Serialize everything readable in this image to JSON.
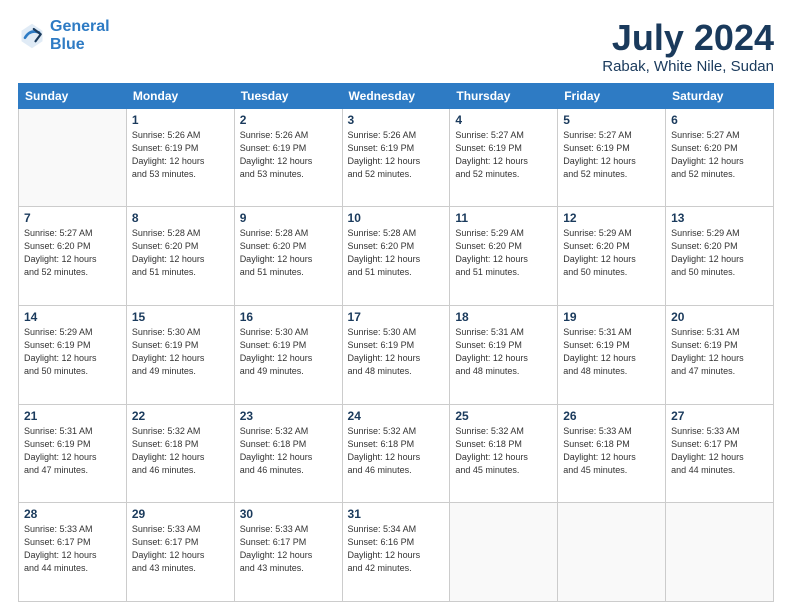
{
  "header": {
    "logo_line1": "General",
    "logo_line2": "Blue",
    "title": "July 2024",
    "subtitle": "Rabak, White Nile, Sudan"
  },
  "calendar": {
    "days_of_week": [
      "Sunday",
      "Monday",
      "Tuesday",
      "Wednesday",
      "Thursday",
      "Friday",
      "Saturday"
    ],
    "weeks": [
      [
        {
          "day": "",
          "info": ""
        },
        {
          "day": "1",
          "info": "Sunrise: 5:26 AM\nSunset: 6:19 PM\nDaylight: 12 hours\nand 53 minutes."
        },
        {
          "day": "2",
          "info": "Sunrise: 5:26 AM\nSunset: 6:19 PM\nDaylight: 12 hours\nand 53 minutes."
        },
        {
          "day": "3",
          "info": "Sunrise: 5:26 AM\nSunset: 6:19 PM\nDaylight: 12 hours\nand 52 minutes."
        },
        {
          "day": "4",
          "info": "Sunrise: 5:27 AM\nSunset: 6:19 PM\nDaylight: 12 hours\nand 52 minutes."
        },
        {
          "day": "5",
          "info": "Sunrise: 5:27 AM\nSunset: 6:19 PM\nDaylight: 12 hours\nand 52 minutes."
        },
        {
          "day": "6",
          "info": "Sunrise: 5:27 AM\nSunset: 6:20 PM\nDaylight: 12 hours\nand 52 minutes."
        }
      ],
      [
        {
          "day": "7",
          "info": "Sunrise: 5:27 AM\nSunset: 6:20 PM\nDaylight: 12 hours\nand 52 minutes."
        },
        {
          "day": "8",
          "info": "Sunrise: 5:28 AM\nSunset: 6:20 PM\nDaylight: 12 hours\nand 51 minutes."
        },
        {
          "day": "9",
          "info": "Sunrise: 5:28 AM\nSunset: 6:20 PM\nDaylight: 12 hours\nand 51 minutes."
        },
        {
          "day": "10",
          "info": "Sunrise: 5:28 AM\nSunset: 6:20 PM\nDaylight: 12 hours\nand 51 minutes."
        },
        {
          "day": "11",
          "info": "Sunrise: 5:29 AM\nSunset: 6:20 PM\nDaylight: 12 hours\nand 51 minutes."
        },
        {
          "day": "12",
          "info": "Sunrise: 5:29 AM\nSunset: 6:20 PM\nDaylight: 12 hours\nand 50 minutes."
        },
        {
          "day": "13",
          "info": "Sunrise: 5:29 AM\nSunset: 6:20 PM\nDaylight: 12 hours\nand 50 minutes."
        }
      ],
      [
        {
          "day": "14",
          "info": "Sunrise: 5:29 AM\nSunset: 6:19 PM\nDaylight: 12 hours\nand 50 minutes."
        },
        {
          "day": "15",
          "info": "Sunrise: 5:30 AM\nSunset: 6:19 PM\nDaylight: 12 hours\nand 49 minutes."
        },
        {
          "day": "16",
          "info": "Sunrise: 5:30 AM\nSunset: 6:19 PM\nDaylight: 12 hours\nand 49 minutes."
        },
        {
          "day": "17",
          "info": "Sunrise: 5:30 AM\nSunset: 6:19 PM\nDaylight: 12 hours\nand 48 minutes."
        },
        {
          "day": "18",
          "info": "Sunrise: 5:31 AM\nSunset: 6:19 PM\nDaylight: 12 hours\nand 48 minutes."
        },
        {
          "day": "19",
          "info": "Sunrise: 5:31 AM\nSunset: 6:19 PM\nDaylight: 12 hours\nand 48 minutes."
        },
        {
          "day": "20",
          "info": "Sunrise: 5:31 AM\nSunset: 6:19 PM\nDaylight: 12 hours\nand 47 minutes."
        }
      ],
      [
        {
          "day": "21",
          "info": "Sunrise: 5:31 AM\nSunset: 6:19 PM\nDaylight: 12 hours\nand 47 minutes."
        },
        {
          "day": "22",
          "info": "Sunrise: 5:32 AM\nSunset: 6:18 PM\nDaylight: 12 hours\nand 46 minutes."
        },
        {
          "day": "23",
          "info": "Sunrise: 5:32 AM\nSunset: 6:18 PM\nDaylight: 12 hours\nand 46 minutes."
        },
        {
          "day": "24",
          "info": "Sunrise: 5:32 AM\nSunset: 6:18 PM\nDaylight: 12 hours\nand 46 minutes."
        },
        {
          "day": "25",
          "info": "Sunrise: 5:32 AM\nSunset: 6:18 PM\nDaylight: 12 hours\nand 45 minutes."
        },
        {
          "day": "26",
          "info": "Sunrise: 5:33 AM\nSunset: 6:18 PM\nDaylight: 12 hours\nand 45 minutes."
        },
        {
          "day": "27",
          "info": "Sunrise: 5:33 AM\nSunset: 6:17 PM\nDaylight: 12 hours\nand 44 minutes."
        }
      ],
      [
        {
          "day": "28",
          "info": "Sunrise: 5:33 AM\nSunset: 6:17 PM\nDaylight: 12 hours\nand 44 minutes."
        },
        {
          "day": "29",
          "info": "Sunrise: 5:33 AM\nSunset: 6:17 PM\nDaylight: 12 hours\nand 43 minutes."
        },
        {
          "day": "30",
          "info": "Sunrise: 5:33 AM\nSunset: 6:17 PM\nDaylight: 12 hours\nand 43 minutes."
        },
        {
          "day": "31",
          "info": "Sunrise: 5:34 AM\nSunset: 6:16 PM\nDaylight: 12 hours\nand 42 minutes."
        },
        {
          "day": "",
          "info": ""
        },
        {
          "day": "",
          "info": ""
        },
        {
          "day": "",
          "info": ""
        }
      ]
    ]
  }
}
